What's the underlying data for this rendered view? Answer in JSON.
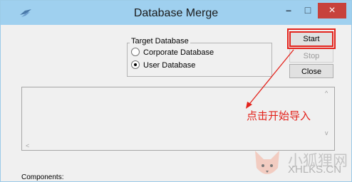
{
  "window": {
    "title": "Database Merge"
  },
  "titlebar_buttons": {
    "minimize": "–",
    "maximize": "□",
    "close": "×"
  },
  "target_database": {
    "legend": "Target Database",
    "options": [
      {
        "label": "Corporate Database",
        "selected": false
      },
      {
        "label": "User Database",
        "selected": true
      }
    ]
  },
  "buttons": {
    "start": "Start",
    "stop": "Stop",
    "close": "Close"
  },
  "annotation": {
    "text": "点击开始导入",
    "color": "#e3231c"
  },
  "components_label": "Components:",
  "watermark": {
    "text": "小狐狸网",
    "url": "XHLKS.CN"
  },
  "icons": {
    "app": "app-logo-icon",
    "fox": "fox-logo-icon"
  }
}
